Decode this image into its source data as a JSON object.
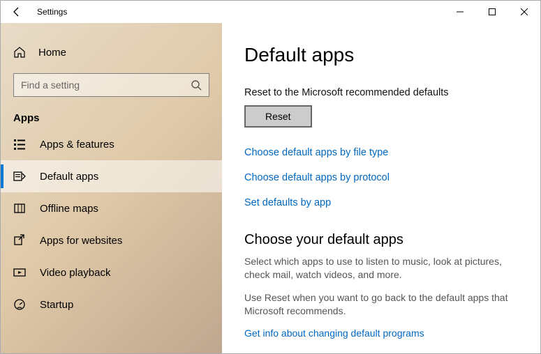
{
  "window": {
    "title": "Settings"
  },
  "sidebar": {
    "home_label": "Home",
    "search_placeholder": "Find a setting",
    "section_label": "Apps",
    "items": [
      {
        "label": "Apps & features"
      },
      {
        "label": "Default apps"
      },
      {
        "label": "Offline maps"
      },
      {
        "label": "Apps for websites"
      },
      {
        "label": "Video playback"
      },
      {
        "label": "Startup"
      }
    ],
    "active_index": 1
  },
  "main": {
    "title": "Default apps",
    "reset_desc": "Reset to the Microsoft recommended defaults",
    "reset_button": "Reset",
    "links": {
      "by_file_type": "Choose default apps by file type",
      "by_protocol": "Choose default apps by protocol",
      "by_app": "Set defaults by app"
    },
    "choose_heading": "Choose your default apps",
    "choose_para1": "Select which apps to use to listen to music, look at pictures, check mail, watch videos, and more.",
    "choose_para2": "Use Reset when you want to go back to the default apps that Microsoft recommends.",
    "info_link": "Get info about changing default programs"
  }
}
